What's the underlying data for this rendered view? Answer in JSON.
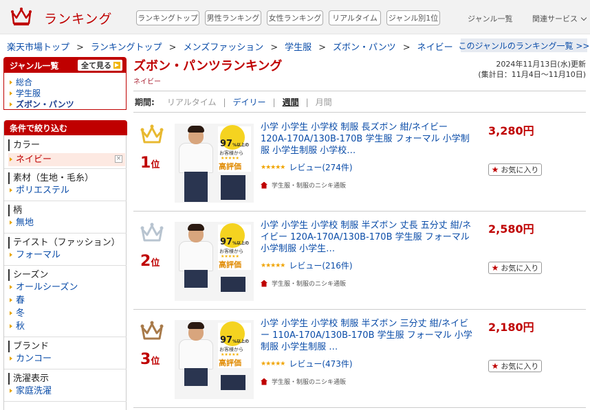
{
  "header": {
    "logo_text": "ランキング",
    "nav_buttons": [
      "ランキングトップ",
      "男性ランキング",
      "女性ランキング",
      "リアルタイム",
      "ジャンル別1位"
    ],
    "genre_list": "ジャンル一覧",
    "related_services": "関連サービス"
  },
  "breadcrumb": {
    "items": [
      "楽天市場トップ",
      "ランキングトップ",
      "メンズファッション",
      "学生服",
      "ズボン・パンツ",
      "ネイビー"
    ],
    "separator": ">",
    "right_link": "このジャンルのランキング一覧 >>"
  },
  "genre_box": {
    "title": "ジャンル一覧",
    "all_button": "全て見る",
    "items": [
      "総合",
      "学生服",
      "ズボン・パンツ"
    ]
  },
  "filter": {
    "title": "条件で絞り込む",
    "groups": [
      {
        "title": "カラー",
        "items": [
          "ネイビー"
        ]
      },
      {
        "title": "素材（生地・毛糸）",
        "items": [
          "ポリエステル"
        ]
      },
      {
        "title": "柄",
        "items": [
          "無地"
        ]
      },
      {
        "title": "テイスト（ファッション）",
        "items": [
          "フォーマル"
        ]
      },
      {
        "title": "シーズン",
        "items": [
          "オールシーズン",
          "春",
          "冬",
          "秋"
        ]
      },
      {
        "title": "ブランド",
        "items": [
          "カンコー"
        ]
      },
      {
        "title": "洗濯表示",
        "items": [
          "家庭洗濯"
        ]
      }
    ],
    "remove_symbol": "×"
  },
  "main": {
    "title": "ズボン・パンツランキング",
    "subtitle": "ネイビー",
    "updated": "2024年11月13日(水)更新",
    "period_range": "(集計日：11月4日～11月10日)"
  },
  "period": {
    "label": "期間:",
    "options": [
      "リアルタイム",
      "デイリー",
      "週間",
      "月間"
    ],
    "separator": "|"
  },
  "items": [
    {
      "rank": "1",
      "rank_suffix": "位",
      "crown_color": "#e8b931",
      "title": "小学 小学生 小学校 制服 長ズボン 紺/ネイビー 120A-170A/130B-170B 学生服 フォーマル 小学制服 小学生制服 小学校…",
      "price": "3,280円",
      "stars": "★★★★★",
      "review": "レビュー(274件)",
      "shop": "学生服・制服のニシキ通販",
      "fav": "お気に入り",
      "badge_pct": "97",
      "badge_pct_unit": "%以上の",
      "badge_text": "お客様から",
      "badge_stars": "★★★★★",
      "badge_high": "高評価"
    },
    {
      "rank": "2",
      "rank_suffix": "位",
      "crown_color": "#b8c4d0",
      "title": "小学 小学生 小学校 制服 半ズボン 丈長 五分丈 紺/ネイビー 120A-170A/130B-170B 学生服 フォーマル 小学制服 小学生…",
      "price": "2,580円",
      "stars": "★★★★★",
      "review": "レビュー(216件)",
      "shop": "学生服・制服のニシキ通販",
      "fav": "お気に入り",
      "badge_pct": "97",
      "badge_pct_unit": "%以上の",
      "badge_text": "お客様から",
      "badge_stars": "★★★★★",
      "badge_high": "高評価"
    },
    {
      "rank": "3",
      "rank_suffix": "位",
      "crown_color": "#a87a4a",
      "title": "小学 小学生 小学校 制服 半ズボン 三分丈 紺/ネイビー 110A-170A/130B-170B 学生服 フォーマル 小学制服 小学生制服 …",
      "price": "2,180円",
      "stars": "★★★★★",
      "review": "レビュー(473件)",
      "shop": "学生服・制服のニシキ通販",
      "fav": "お気に入り",
      "badge_pct": "97",
      "badge_pct_unit": "%以上の",
      "badge_text": "お客様から",
      "badge_stars": "★★★★★",
      "badge_high": "高評価"
    }
  ],
  "colors": {
    "brand": "#bf0000",
    "link": "#0a4ca8"
  }
}
